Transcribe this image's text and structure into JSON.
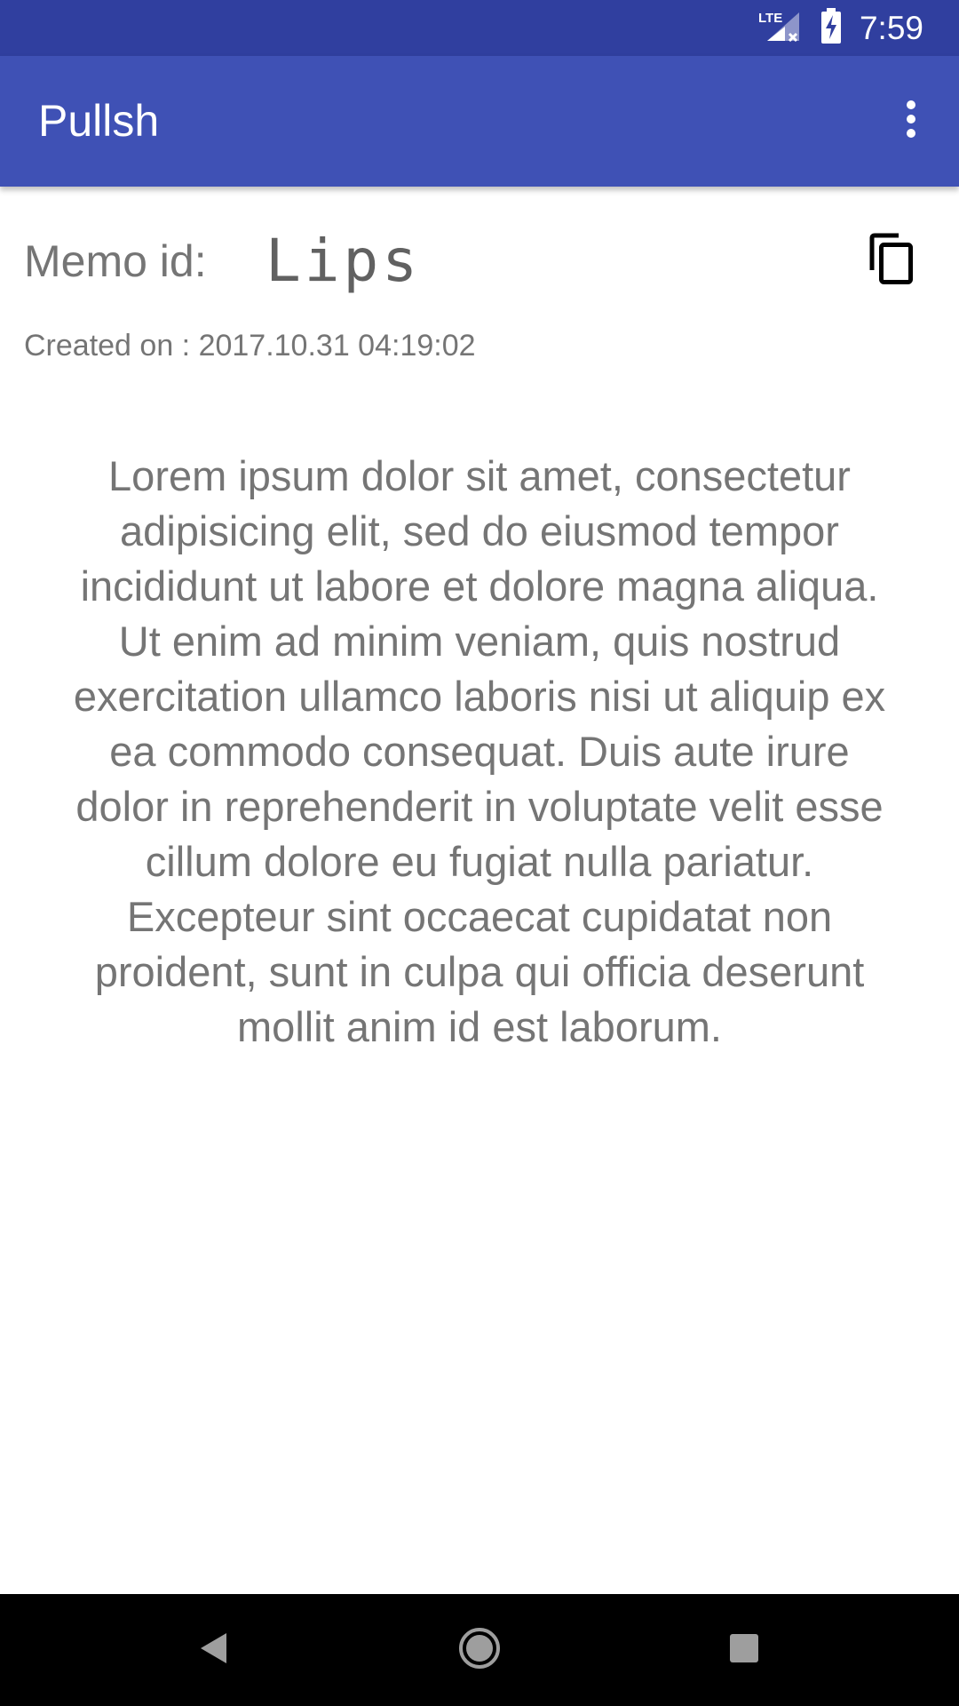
{
  "status_bar": {
    "network_label": "LTE",
    "time": "7:59",
    "icons": [
      "lte-signal-icon",
      "battery-charging-icon"
    ]
  },
  "app_bar": {
    "title": "Pullsh",
    "overflow_icon": "more-vert-icon"
  },
  "memo": {
    "id_label": "Memo id:",
    "id_value": "Lips",
    "copy_icon": "copy-icon",
    "created_on": "Created on : 2017.10.31 04:19:02",
    "text": "Lorem ipsum dolor sit amet, consectetur adipisicing elit, sed do eiusmod tempor incididunt ut labore et dolore magna aliqua. Ut enim ad minim veniam, quis nostrud exercitation ullamco laboris nisi ut aliquip ex ea commodo consequat. Duis aute irure dolor in reprehenderit in voluptate velit esse cillum dolore eu fugiat nulla pariatur. Excepteur sint occaecat cupidatat non proident, sunt in culpa qui officia deserunt mollit anim id est laborum."
  },
  "nav_bar": {
    "buttons": [
      "back-icon",
      "home-icon",
      "recents-icon"
    ]
  },
  "colors": {
    "status_bar": "#303F9F",
    "app_bar": "#3F51B5",
    "text_secondary": "#757575"
  }
}
